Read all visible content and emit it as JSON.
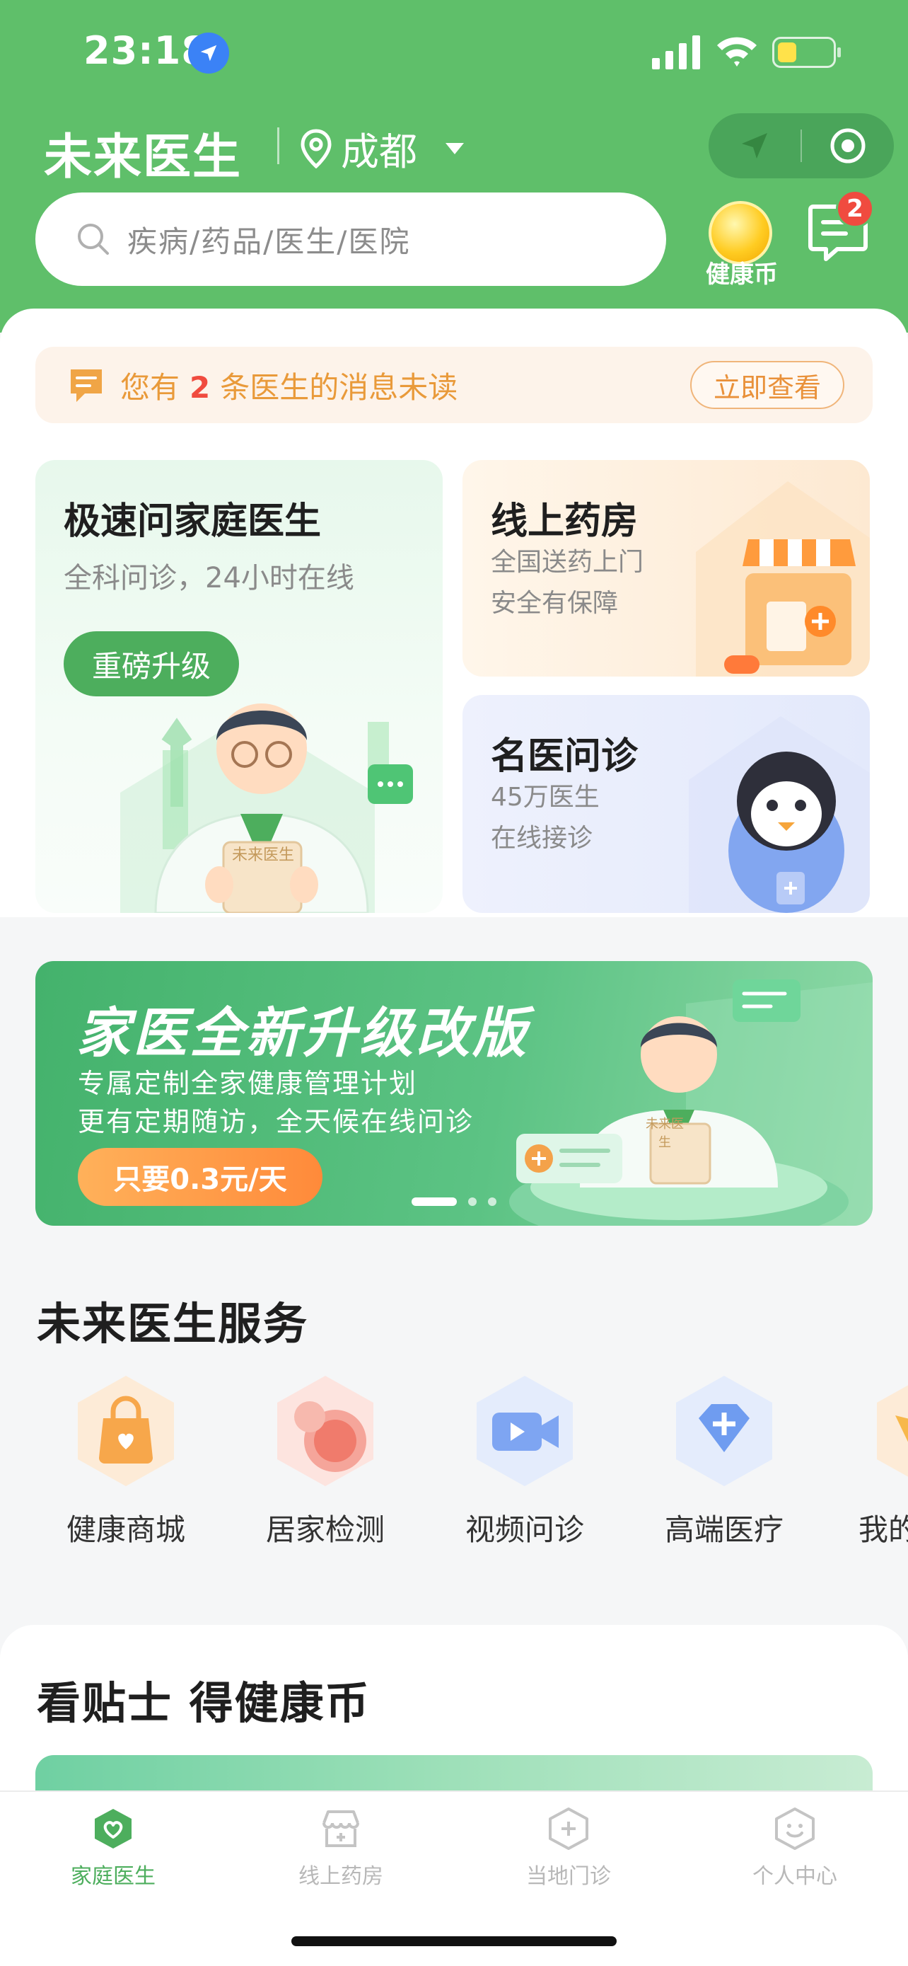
{
  "status_bar": {
    "time": "23:18"
  },
  "header": {
    "brand": "未来医生",
    "city": "成都",
    "search_placeholder": "疾病/药品/医生/医院",
    "coin_label": "健康币",
    "message_badge": "2"
  },
  "notice": {
    "prefix": "您有",
    "count": "2",
    "suffix": "条医生的消息未读",
    "action": "立即查看"
  },
  "cards": {
    "family": {
      "title": "极速问家庭医生",
      "subtitle": "全科问诊，24小时在线",
      "pill": "重磅升级",
      "clipboard": "未来医生"
    },
    "pharmacy": {
      "title": "线上药房",
      "line1": "全国送药上门",
      "line2": "安全有保障"
    },
    "famous": {
      "title": "名医问诊",
      "line1": "45万医生",
      "line2": "在线接诊"
    }
  },
  "banner": {
    "title": "家医全新升级改版",
    "line1": "专属定制全家健康管理计划",
    "line2": "更有定期随访，全天候在线问诊",
    "price": "只要0.3元/天",
    "clipboard": "未来医生"
  },
  "services": {
    "title": "未来医生服务",
    "items": [
      {
        "label": "健康商城",
        "icon": "shopping-bag-icon"
      },
      {
        "label": "居家检测",
        "icon": "home-test-icon"
      },
      {
        "label": "视频问诊",
        "icon": "video-call-icon"
      },
      {
        "label": "高端医疗",
        "icon": "diamond-cross-icon"
      },
      {
        "label": "我的",
        "icon": "partial-icon"
      }
    ]
  },
  "tips": {
    "title": "看贴士 得健康币"
  },
  "tabbar": {
    "tabs": [
      {
        "label": "家庭医生",
        "active": true
      },
      {
        "label": "线上药房",
        "active": false
      },
      {
        "label": "当地门诊",
        "active": false
      },
      {
        "label": "个人中心",
        "active": false
      }
    ]
  },
  "colors": {
    "brand_green": "#5fbf6a",
    "accent_orange": "#e99a3a",
    "badge_red": "#f04b3f"
  }
}
